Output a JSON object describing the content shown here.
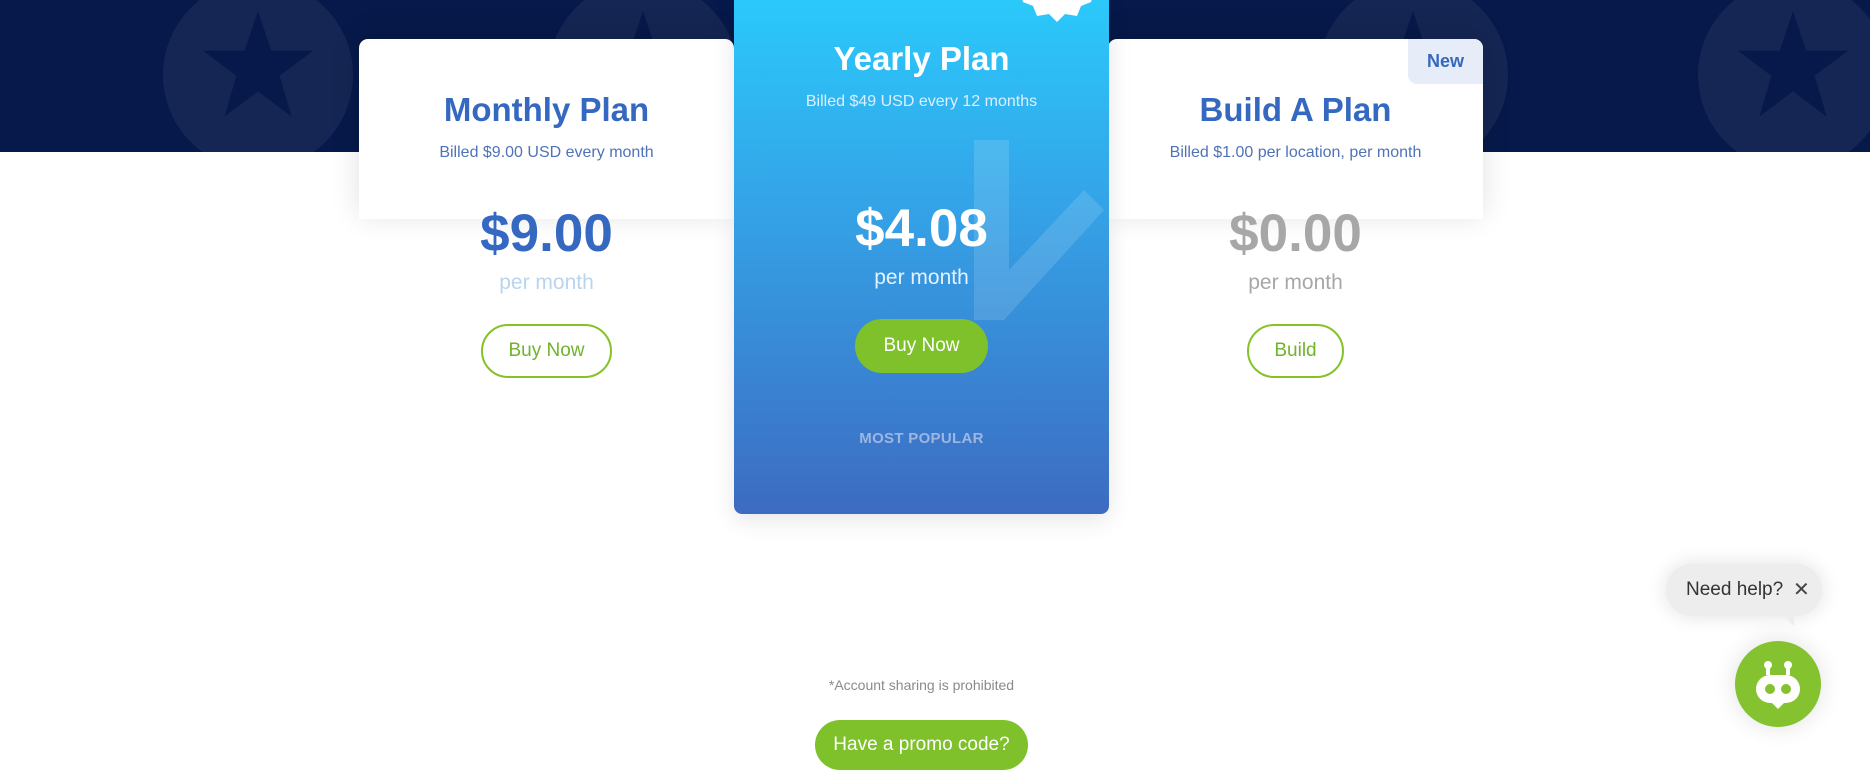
{
  "plans": {
    "monthly": {
      "title": "Monthly Plan",
      "billed": "Billed $9.00 USD every month",
      "price": "$9.00",
      "per": "per month",
      "button": "Buy Now"
    },
    "yearly": {
      "title": "Yearly Plan",
      "billed": "Billed $49 USD every 12 months",
      "price": "$4.08",
      "per": "per month",
      "button": "Buy Now",
      "tag": "MOST POPULAR"
    },
    "build": {
      "badge": "New",
      "title": "Build A Plan",
      "billed": "Billed $1.00 per location, per month",
      "price": "$0.00",
      "per": "per month",
      "button": "Build"
    }
  },
  "footer": {
    "disclaimer": "*Account sharing is prohibited",
    "promo": "Have a promo code?"
  },
  "chat": {
    "help_text": "Need help?",
    "close_glyph": "✕",
    "bot_icon": "robot-icon"
  },
  "colors": {
    "navy": "#07194a",
    "blue": "#3568c0",
    "green": "#7ec12a",
    "gradient_top": "#2bc9fb",
    "gradient_bottom": "#3d6bc2"
  }
}
